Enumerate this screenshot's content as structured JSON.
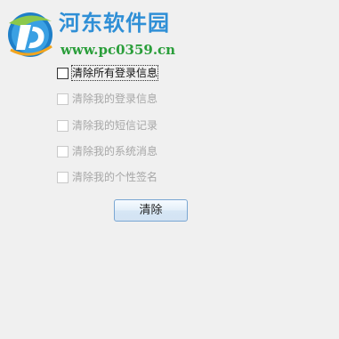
{
  "watermark": {
    "title": "河东软件园",
    "url": "www.pc0359.cn"
  },
  "options": [
    {
      "label": "清除所有登录信息",
      "checked": false,
      "enabled": true,
      "focused": true
    },
    {
      "label": "清除我的登录信息",
      "checked": false,
      "enabled": false,
      "focused": false
    },
    {
      "label": "清除我的短信记录",
      "checked": false,
      "enabled": false,
      "focused": false
    },
    {
      "label": "清除我的系统消息",
      "checked": false,
      "enabled": false,
      "focused": false
    },
    {
      "label": "清除我的个性签名",
      "checked": false,
      "enabled": false,
      "focused": false
    }
  ],
  "actions": {
    "clear_label": "清除"
  },
  "colors": {
    "background": "#f0f0f0",
    "logo_blue": "#2f8fd6",
    "logo_green": "#2a9e3a",
    "disabled_text": "#a7a7a7",
    "button_border": "#7aa7d3"
  }
}
